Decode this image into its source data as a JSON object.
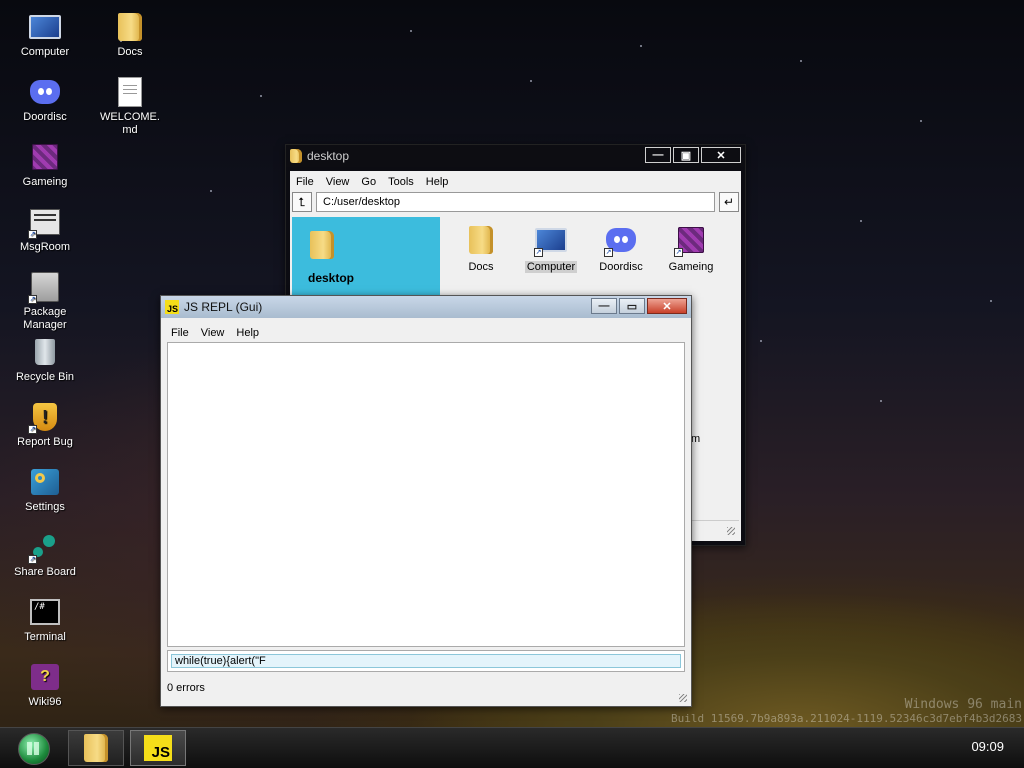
{
  "desktop": {
    "icons": [
      {
        "label": "Computer",
        "icon": "computer-icon"
      },
      {
        "label": "Docs",
        "icon": "folder-icon"
      },
      {
        "label": "Doordisc",
        "icon": "doordisc-icon"
      },
      {
        "label": "WELCOME.\nmd",
        "icon": "document-icon"
      },
      {
        "label": "Gameing",
        "icon": "cube-icon"
      },
      {
        "label": "MsgRoom",
        "icon": "msgroom-icon"
      },
      {
        "label": "Package\nManager",
        "icon": "package-icon"
      },
      {
        "label": "Recycle Bin",
        "icon": "recycle-bin-icon"
      },
      {
        "label": "Report Bug",
        "icon": "shield-icon"
      },
      {
        "label": "Settings",
        "icon": "settings-icon"
      },
      {
        "label": "Share Board",
        "icon": "share-icon"
      },
      {
        "label": "Terminal",
        "icon": "terminal-icon"
      },
      {
        "label": "Wiki96",
        "icon": "wiki-icon"
      }
    ]
  },
  "explorer": {
    "title": "desktop",
    "menu": [
      "File",
      "View",
      "Go",
      "Tools",
      "Help"
    ],
    "path": "C:/user/desktop",
    "sidebar_label": "desktop",
    "files": [
      {
        "label": "Docs",
        "icon": "folder-icon"
      },
      {
        "label": "Computer",
        "icon": "computer-icon",
        "selected": true
      },
      {
        "label": "Doordisc",
        "icon": "doordisc-icon"
      },
      {
        "label": "Gameing",
        "icon": "cube-icon"
      }
    ],
    "partial_text": ".m"
  },
  "repl": {
    "title": "JS REPL (Gui)",
    "menu": [
      "File",
      "View",
      "Help"
    ],
    "input_value": "while(true){alert(\"F",
    "status": "0 errors"
  },
  "watermark": {
    "line1": "Windows 96 main",
    "line2": "Build 11569.7b9a893a.211024-1119.52346c3d7ebf4b3d2683"
  },
  "taskbar": {
    "js_badge": "JS",
    "clock": "09:09"
  }
}
